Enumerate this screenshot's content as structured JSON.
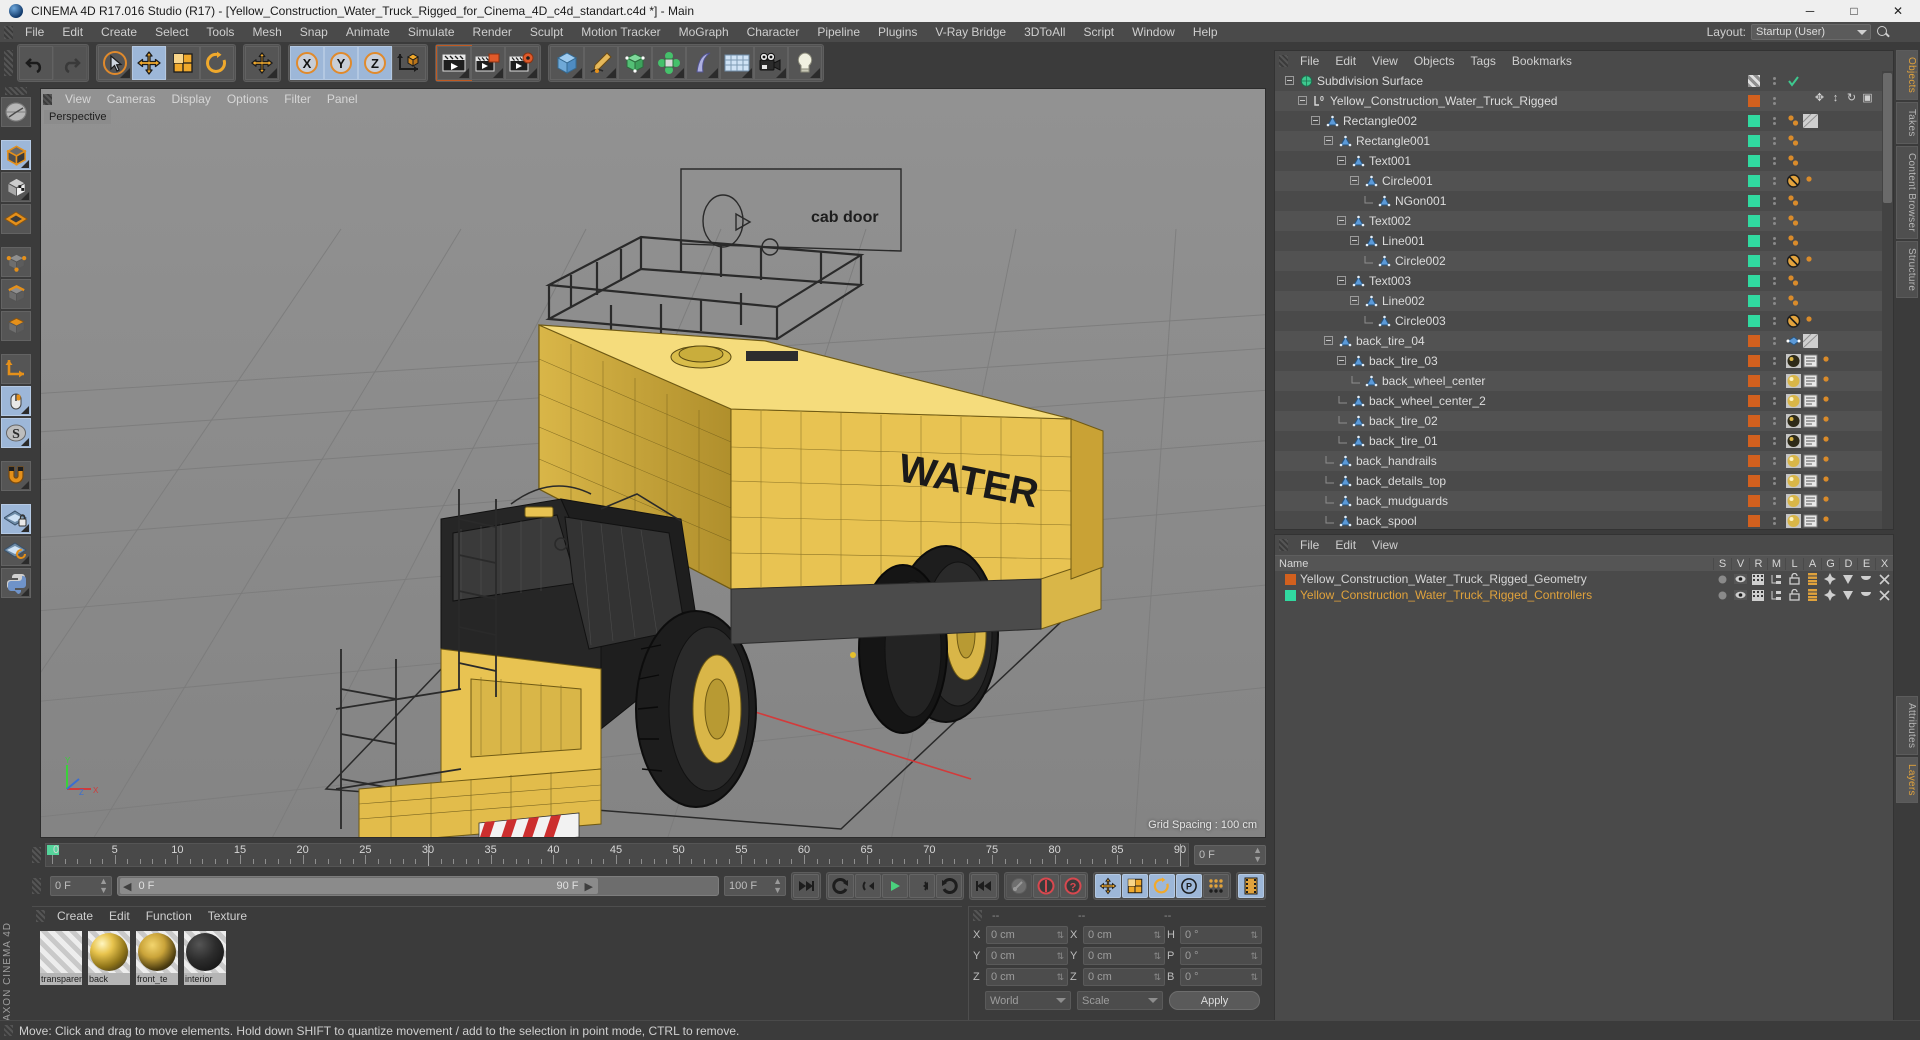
{
  "window": {
    "title": "CINEMA 4D R17.016 Studio (R17) - [Yellow_Construction_Water_Truck_Rigged_for_Cinema_4D_c4d_standart.c4d *] - Main",
    "minimize": "─",
    "maximize": "□",
    "close": "✕"
  },
  "menubar": {
    "items": [
      {
        "label": "File"
      },
      {
        "label": "Edit"
      },
      {
        "label": "Create"
      },
      {
        "label": "Select"
      },
      {
        "label": "Tools"
      },
      {
        "label": "Mesh"
      },
      {
        "label": "Snap"
      },
      {
        "label": "Animate"
      },
      {
        "label": "Simulate"
      },
      {
        "label": "Render"
      },
      {
        "label": "Sculpt"
      },
      {
        "label": "Motion Tracker"
      },
      {
        "label": "MoGraph"
      },
      {
        "label": "Character"
      },
      {
        "label": "Pipeline"
      },
      {
        "label": "Plugins"
      },
      {
        "label": "V-Ray Bridge"
      },
      {
        "label": "3DToAll"
      },
      {
        "label": "Script"
      },
      {
        "label": "Window"
      },
      {
        "label": "Help"
      }
    ],
    "layout_label": "Layout:",
    "layout_value": "Startup (User)"
  },
  "viewport": {
    "menu": [
      {
        "label": "View"
      },
      {
        "label": "Cameras"
      },
      {
        "label": "Display"
      },
      {
        "label": "Options"
      },
      {
        "label": "Filter"
      },
      {
        "label": "Panel"
      }
    ],
    "view_label": "Perspective",
    "grid_spacing": "Grid Spacing : 100 cm",
    "axis_x": "X",
    "axis_y": "Y",
    "axis_z": "Z",
    "model_text_cab": "cab door",
    "model_text_water": "WATER"
  },
  "timeline": {
    "ticks": [
      "0",
      "5",
      "10",
      "15",
      "20",
      "25",
      "30",
      "35",
      "40",
      "45",
      "50",
      "55",
      "60",
      "65",
      "70",
      "75",
      "80",
      "85",
      "90"
    ],
    "current_frame": "0 F",
    "current_frame_right": "0 F",
    "range_start": "0 F",
    "range_end": "90 F",
    "max_frame": "100 F"
  },
  "material_manager": {
    "menu": [
      {
        "label": "Create"
      },
      {
        "label": "Edit"
      },
      {
        "label": "Function"
      },
      {
        "label": "Texture"
      }
    ],
    "materials": [
      {
        "name": "transparent",
        "color": "#cfcfcf",
        "kind": "checker"
      },
      {
        "name": "back",
        "color": "#e0b945",
        "kind": "yellow"
      },
      {
        "name": "front_te",
        "color": "#d7b13c",
        "kind": "yellowdark"
      },
      {
        "name": "interior",
        "color": "#2a2a2a",
        "kind": "dark"
      }
    ]
  },
  "coordinates": {
    "header": [
      "--",
      "--",
      "--"
    ],
    "rows": [
      {
        "pos_axis": "X",
        "pos_value": "0 cm",
        "size_axis": "X",
        "size_value": "0 cm",
        "rot_axis": "H",
        "rot_value": "0 °"
      },
      {
        "pos_axis": "Y",
        "pos_value": "0 cm",
        "size_axis": "Y",
        "size_value": "0 cm",
        "rot_axis": "P",
        "rot_value": "0 °"
      },
      {
        "pos_axis": "Z",
        "pos_value": "0 cm",
        "size_axis": "Z",
        "size_value": "0 cm",
        "rot_axis": "B",
        "rot_value": "0 °"
      }
    ],
    "world_select": "World",
    "scale_select": "Scale",
    "apply_button": "Apply"
  },
  "object_manager": {
    "menu": [
      {
        "label": "File"
      },
      {
        "label": "Edit"
      },
      {
        "label": "View"
      },
      {
        "label": "Objects"
      },
      {
        "label": "Tags"
      },
      {
        "label": "Bookmarks"
      }
    ],
    "rows": [
      {
        "label": "Subdivision Surface",
        "depth": 0,
        "icon": "subdivision-surface",
        "expander": "minus",
        "swatch": "#ffffff",
        "swatch_kind": "checker",
        "tags": [
          "check"
        ]
      },
      {
        "label": "Yellow_Construction_Water_Truck_Rigged",
        "depth": 1,
        "icon": "null-object",
        "expander": "minus",
        "swatch": "#d2601e",
        "tags": []
      },
      {
        "label": "Rectangle002",
        "depth": 2,
        "icon": "spline",
        "expander": "minus",
        "swatch": "#31d9a0",
        "tags": [
          "dots",
          "checker"
        ]
      },
      {
        "label": "Rectangle001",
        "depth": 3,
        "icon": "spline",
        "expander": "minus",
        "swatch": "#31d9a0",
        "tags": [
          "dots"
        ]
      },
      {
        "label": "Text001",
        "depth": 4,
        "icon": "spline",
        "expander": "minus",
        "swatch": "#31d9a0",
        "tags": [
          "dots"
        ]
      },
      {
        "label": "Circle001",
        "depth": 5,
        "icon": "spline",
        "expander": "minus",
        "swatch": "#31d9a0",
        "tags": [
          "ban",
          "dot"
        ]
      },
      {
        "label": "NGon001",
        "depth": 6,
        "icon": "spline",
        "expander": "none",
        "swatch": "#31d9a0",
        "tags": [
          "dots"
        ]
      },
      {
        "label": "Text002",
        "depth": 4,
        "icon": "spline",
        "expander": "minus",
        "swatch": "#31d9a0",
        "tags": [
          "dots"
        ]
      },
      {
        "label": "Line001",
        "depth": 5,
        "icon": "spline",
        "expander": "minus",
        "swatch": "#31d9a0",
        "tags": [
          "dots"
        ]
      },
      {
        "label": "Circle002",
        "depth": 6,
        "icon": "spline",
        "expander": "none",
        "swatch": "#31d9a0",
        "tags": [
          "ban",
          "dot"
        ]
      },
      {
        "label": "Text003",
        "depth": 4,
        "icon": "spline",
        "expander": "minus",
        "swatch": "#31d9a0",
        "tags": [
          "dots"
        ]
      },
      {
        "label": "Line002",
        "depth": 5,
        "icon": "spline",
        "expander": "minus",
        "swatch": "#31d9a0",
        "tags": [
          "dots"
        ]
      },
      {
        "label": "Circle003",
        "depth": 6,
        "icon": "spline",
        "expander": "none",
        "swatch": "#31d9a0",
        "tags": [
          "ban",
          "dot"
        ]
      },
      {
        "label": "back_tire_04",
        "depth": 3,
        "icon": "polygon",
        "expander": "minus",
        "swatch": "#d2601e",
        "tags": [
          "point",
          "checker"
        ]
      },
      {
        "label": "back_tire_03",
        "depth": 4,
        "icon": "polygon",
        "expander": "minus",
        "swatch": "#d2601e",
        "tags": [
          "mat-dark",
          "mat2",
          "dot"
        ]
      },
      {
        "label": "back_wheel_center",
        "depth": 5,
        "icon": "polygon",
        "expander": "none",
        "swatch": "#d2601e",
        "tags": [
          "mat-yellow",
          "mat2",
          "dot"
        ]
      },
      {
        "label": "back_wheel_center_2",
        "depth": 4,
        "icon": "polygon",
        "expander": "none",
        "swatch": "#d2601e",
        "tags": [
          "mat-yellow",
          "mat2",
          "dot"
        ]
      },
      {
        "label": "back_tire_02",
        "depth": 4,
        "icon": "polygon",
        "expander": "none",
        "swatch": "#d2601e",
        "tags": [
          "mat-dark",
          "mat2",
          "dot"
        ]
      },
      {
        "label": "back_tire_01",
        "depth": 4,
        "icon": "polygon",
        "expander": "none",
        "swatch": "#d2601e",
        "tags": [
          "mat-dark",
          "mat2",
          "dot"
        ]
      },
      {
        "label": "back_handrails",
        "depth": 3,
        "icon": "polygon",
        "expander": "none",
        "swatch": "#d2601e",
        "tags": [
          "mat-yellow",
          "mat2",
          "dot"
        ]
      },
      {
        "label": "back_details_top",
        "depth": 3,
        "icon": "polygon",
        "expander": "none",
        "swatch": "#d2601e",
        "tags": [
          "mat-yellow",
          "mat2",
          "dot"
        ]
      },
      {
        "label": "back_mudguards",
        "depth": 3,
        "icon": "polygon",
        "expander": "none",
        "swatch": "#d2601e",
        "tags": [
          "mat-yellow",
          "mat2",
          "dot"
        ]
      },
      {
        "label": "back_spool",
        "depth": 3,
        "icon": "polygon",
        "expander": "none",
        "swatch": "#d2601e",
        "tags": [
          "mat-yellow",
          "mat2",
          "dot"
        ]
      }
    ]
  },
  "layer_manager": {
    "menu": [
      {
        "label": "File"
      },
      {
        "label": "Edit"
      },
      {
        "label": "View"
      }
    ],
    "columns": [
      "Name",
      "S",
      "V",
      "R",
      "M",
      "L",
      "A",
      "G",
      "D",
      "E",
      "X"
    ],
    "rows": [
      {
        "label": "Yellow_Construction_Water_Truck_Rigged_Geometry",
        "color": "#d2601e",
        "selected": false
      },
      {
        "label": "Yellow_Construction_Water_Truck_Rigged_Controllers",
        "color": "#31d9a0",
        "selected": true
      }
    ]
  },
  "edge_tabs": {
    "top": [
      {
        "label": "Objects",
        "active": true
      },
      {
        "label": "Takes",
        "active": false
      },
      {
        "label": "Content Browser",
        "active": false
      },
      {
        "label": "Structure",
        "active": false
      }
    ],
    "bottom": [
      {
        "label": "Attributes",
        "active": false
      },
      {
        "label": "Layers",
        "active": true
      }
    ]
  },
  "statusbar": {
    "text": "Move: Click and drag to move elements. Hold down SHIFT to quantize movement / add to the selection in point mode, CTRL to remove."
  },
  "colors": {
    "accent_orange": "#e0a23c",
    "geometry_orange": "#d2601e",
    "controller_green": "#31d9a0",
    "selection_blue": "#9db7d8",
    "background": "#3b3b3b"
  }
}
